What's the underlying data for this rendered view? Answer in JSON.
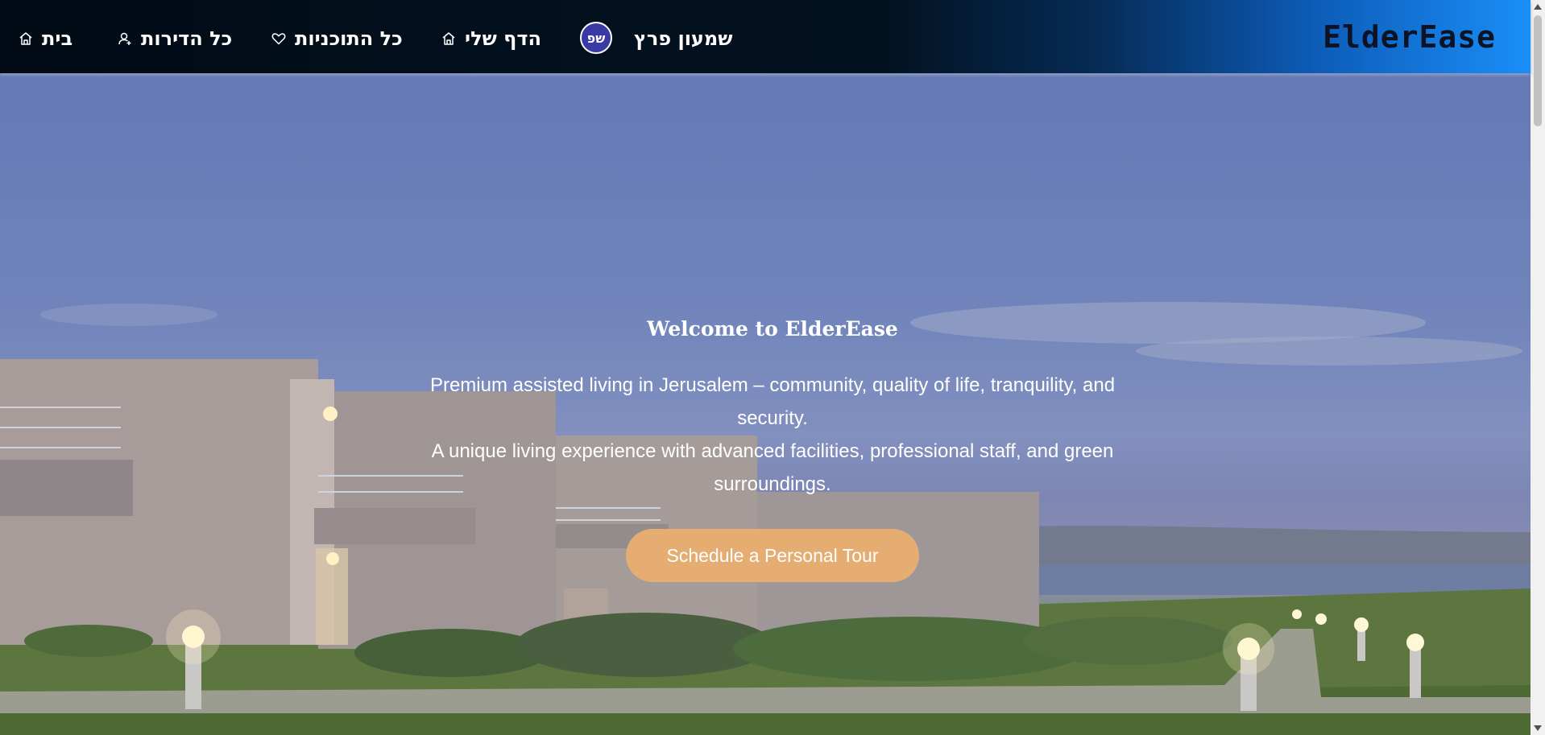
{
  "header": {
    "logo": "ElderEase",
    "nav": {
      "home": "בית",
      "apartments": "כל הדירות",
      "programs": "כל התוכניות",
      "my_page": "הדף שלי",
      "user_name": "שמעון פרץ",
      "avatar_initials": "שפ"
    }
  },
  "hero": {
    "title": "Welcome to ElderEase",
    "line1": "Premium assisted living in Jerusalem – community, quality of life, tranquility, and",
    "line2": "security.",
    "line3": "A unique living experience with advanced facilities, professional staff, and green",
    "line4": "surroundings.",
    "cta_label": "Schedule a Personal Tour"
  },
  "colors": {
    "accent": "#e6ad72",
    "nav_dark": "#020b16",
    "nav_light": "#1a8ef8",
    "avatar": "#3a3aa6"
  }
}
